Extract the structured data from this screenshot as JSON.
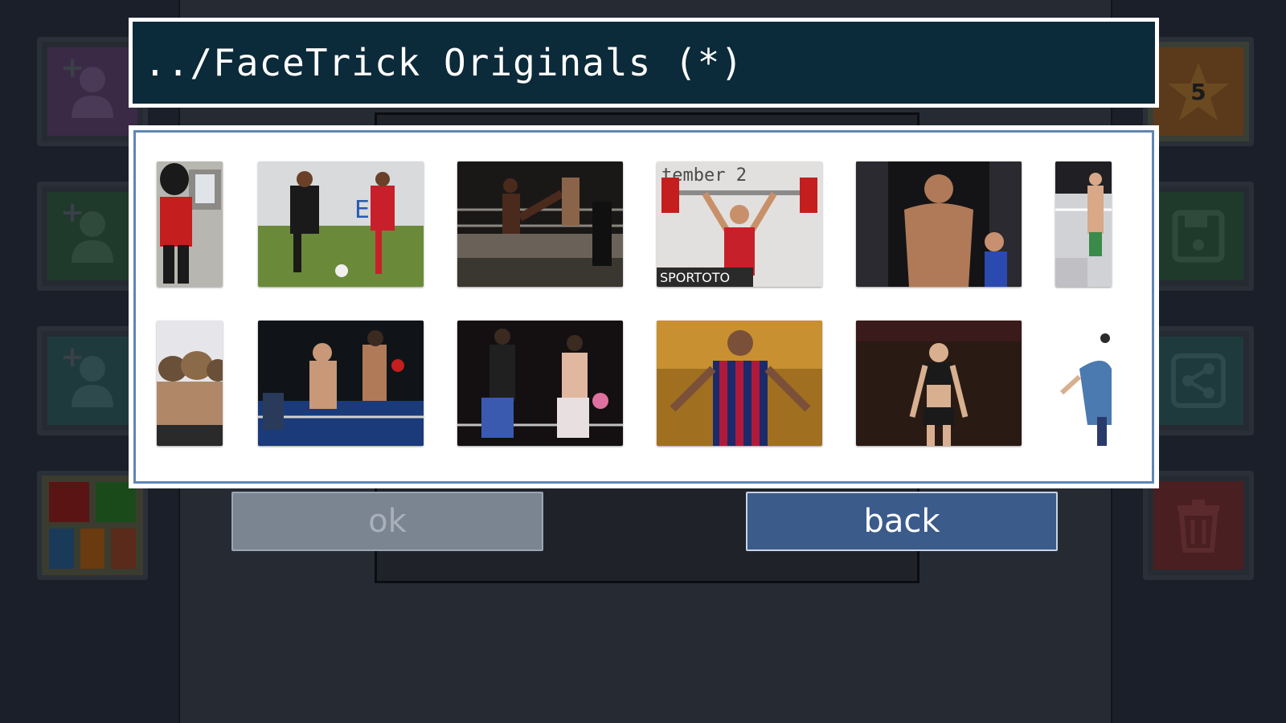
{
  "dialog": {
    "title": "../FaceTrick Originals (*)",
    "ok_label": "ok",
    "back_label": "back"
  },
  "background": {
    "left_buttons": [
      {
        "icon": "add-person-icon",
        "color": "#3a2a45"
      },
      {
        "icon": "add-person-icon",
        "color": "#1f3a2a"
      },
      {
        "icon": "add-person-icon",
        "color": "#1f3a3c"
      },
      {
        "icon": "color-palette-icon",
        "color": "#3a3c2f"
      }
    ],
    "right_buttons": [
      {
        "icon": "star-icon",
        "badge": "5",
        "color": "#5a3a1a"
      },
      {
        "icon": "save-icon",
        "color": "#1f3a2a"
      },
      {
        "icon": "share-icon",
        "color": "#1f3a3c"
      },
      {
        "icon": "trash-icon",
        "color": "#4a1f22"
      }
    ]
  },
  "gallery": {
    "rows": [
      [
        {
          "subject": "guard-in-red-uniform"
        },
        {
          "subject": "soccer-players"
        },
        {
          "subject": "kickboxing-match"
        },
        {
          "subject": "weightlifter"
        },
        {
          "subject": "mma-fighter-weigh-in"
        },
        {
          "subject": "boxer-in-ring"
        }
      ],
      [
        {
          "subject": "group-in-fur-hats"
        },
        {
          "subject": "boxing-match"
        },
        {
          "subject": "muay-thai-fighters"
        },
        {
          "subject": "soccer-player-striped-kit"
        },
        {
          "subject": "female-mma-fighter"
        },
        {
          "subject": "cartoon-figure"
        }
      ]
    ]
  }
}
